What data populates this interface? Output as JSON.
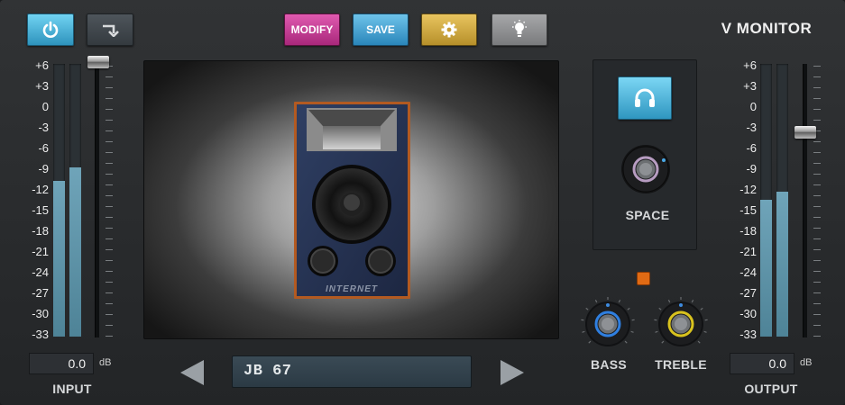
{
  "header": {
    "title": "V MONITOR",
    "modify_label": "MODIFY",
    "save_label": "SAVE"
  },
  "meters": {
    "scale": [
      "+6",
      "+3",
      "0",
      "-3",
      "-6",
      "-9",
      "-12",
      "-15",
      "-18",
      "-21",
      "-24",
      "-27",
      "-30",
      "-33"
    ],
    "input": {
      "caption": "INPUT",
      "value": "0.0",
      "unit": "dB",
      "level_left": 0.57,
      "level_right": 0.62,
      "fader_position": 0.0
    },
    "output": {
      "caption": "OUTPUT",
      "value": "0.0",
      "unit": "dB",
      "level_left": 0.5,
      "level_right": 0.53,
      "fader_position": 0.26
    }
  },
  "display": {
    "speaker_brand": "INTERNET",
    "preset_name": "JB 67"
  },
  "space": {
    "label": "SPACE",
    "headphones_active": true,
    "led_color": "#e06a14"
  },
  "eq": {
    "bass_label": "BASS",
    "treble_label": "TREBLE",
    "bass_ring_color": "#2f7fe0",
    "treble_ring_color": "#d8c21e"
  },
  "colors": {
    "accent_blue": "#2e93bd",
    "modify_pink": "#c0358f",
    "settings_yellow": "#d4ac40",
    "meter_fill": "#5d93a8"
  },
  "icons": {
    "power": "power-icon",
    "route": "route-arrow-icon",
    "settings": "gear-icon",
    "light": "lightbulb-icon",
    "headphones": "headphones-icon",
    "prev": "arrow-left-icon",
    "next": "arrow-right-icon"
  }
}
